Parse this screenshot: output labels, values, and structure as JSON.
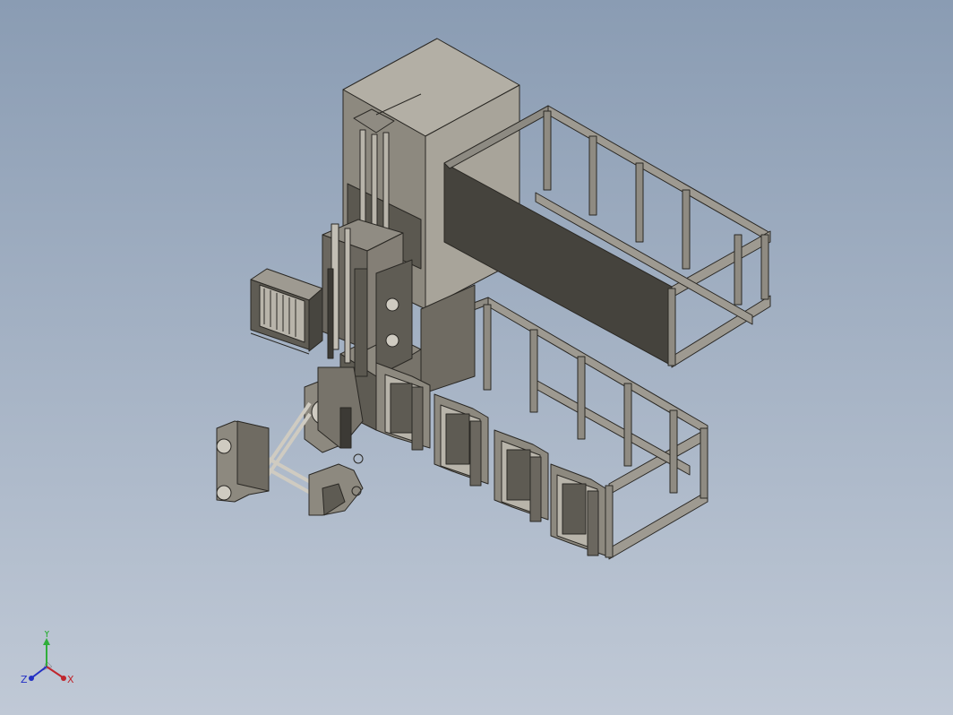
{
  "viewport": {
    "background_top": "#8a9cb3",
    "background_bottom": "#c0c9d6"
  },
  "model": {
    "body_color": "#a39f95",
    "shade_color": "#6f6b62",
    "dark_color": "#3c3a35",
    "edge_color": "#2a2824"
  },
  "triad": {
    "x_label": "X",
    "y_label": "Y",
    "z_label": "Z",
    "x_color": "#c0262d",
    "y_color": "#2fae3a",
    "z_color": "#2330c4"
  }
}
